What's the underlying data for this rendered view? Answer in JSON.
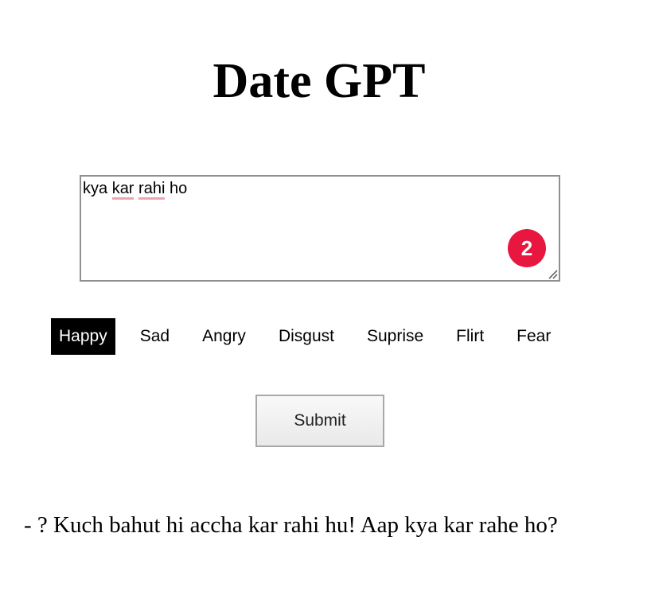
{
  "page": {
    "title": "Date GPT"
  },
  "input": {
    "words": [
      "kya",
      "kar",
      "rahi",
      "ho"
    ],
    "misspelled": [
      false,
      true,
      true,
      false
    ],
    "badge_count": "2"
  },
  "emotions": {
    "items": [
      "Happy",
      "Sad",
      "Angry",
      "Disgust",
      "Suprise",
      "Flirt",
      "Fear"
    ],
    "selected": "Happy"
  },
  "submit": {
    "label": "Submit"
  },
  "response": {
    "text": "- ? Kuch bahut hi accha kar rahi hu! Aap kya kar rahe ho?"
  },
  "colors": {
    "badge": "#e8173f",
    "spellcheck_underline": "#f0a2b0",
    "selected_emotion_bg": "#000000"
  }
}
